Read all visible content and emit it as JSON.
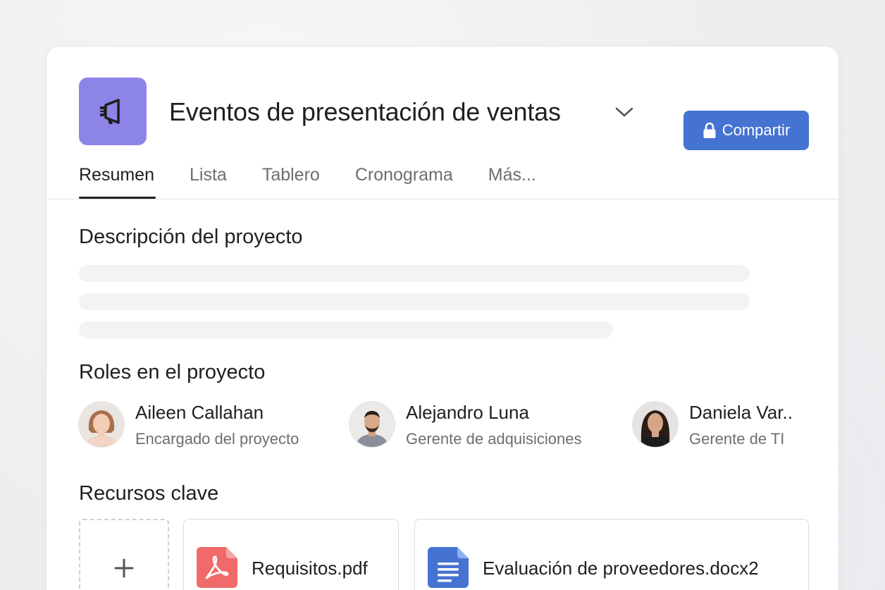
{
  "project": {
    "title": "Eventos de presentación de ventas",
    "icon": "megaphone-icon",
    "icon_color": "#8d84e8"
  },
  "header": {
    "share_label": "Compartir",
    "share_icon": "lock-icon",
    "share_color": "#4573d2"
  },
  "tabs": [
    {
      "label": "Resumen",
      "active": true
    },
    {
      "label": "Lista",
      "active": false
    },
    {
      "label": "Tablero",
      "active": false
    },
    {
      "label": "Cronograma",
      "active": false
    },
    {
      "label": "Más...",
      "active": false
    }
  ],
  "sections": {
    "description_title": "Descripción del proyecto",
    "roles_title": "Roles en el proyecto",
    "resources_title": "Recursos clave"
  },
  "roles": [
    {
      "name": "Aileen Callahan",
      "role": "Encargado del proyecto"
    },
    {
      "name": "Alejandro Luna",
      "role": "Gerente de adquisiciones"
    },
    {
      "name": "Daniela Var..",
      "role": "Gerente de TI"
    }
  ],
  "resources": [
    {
      "name": "Requisitos.pdf",
      "icon": "pdf-icon",
      "color": "#f06a6a"
    },
    {
      "name": "Evaluación de proveedores.docx2",
      "icon": "document-icon",
      "color": "#4573d2"
    }
  ]
}
